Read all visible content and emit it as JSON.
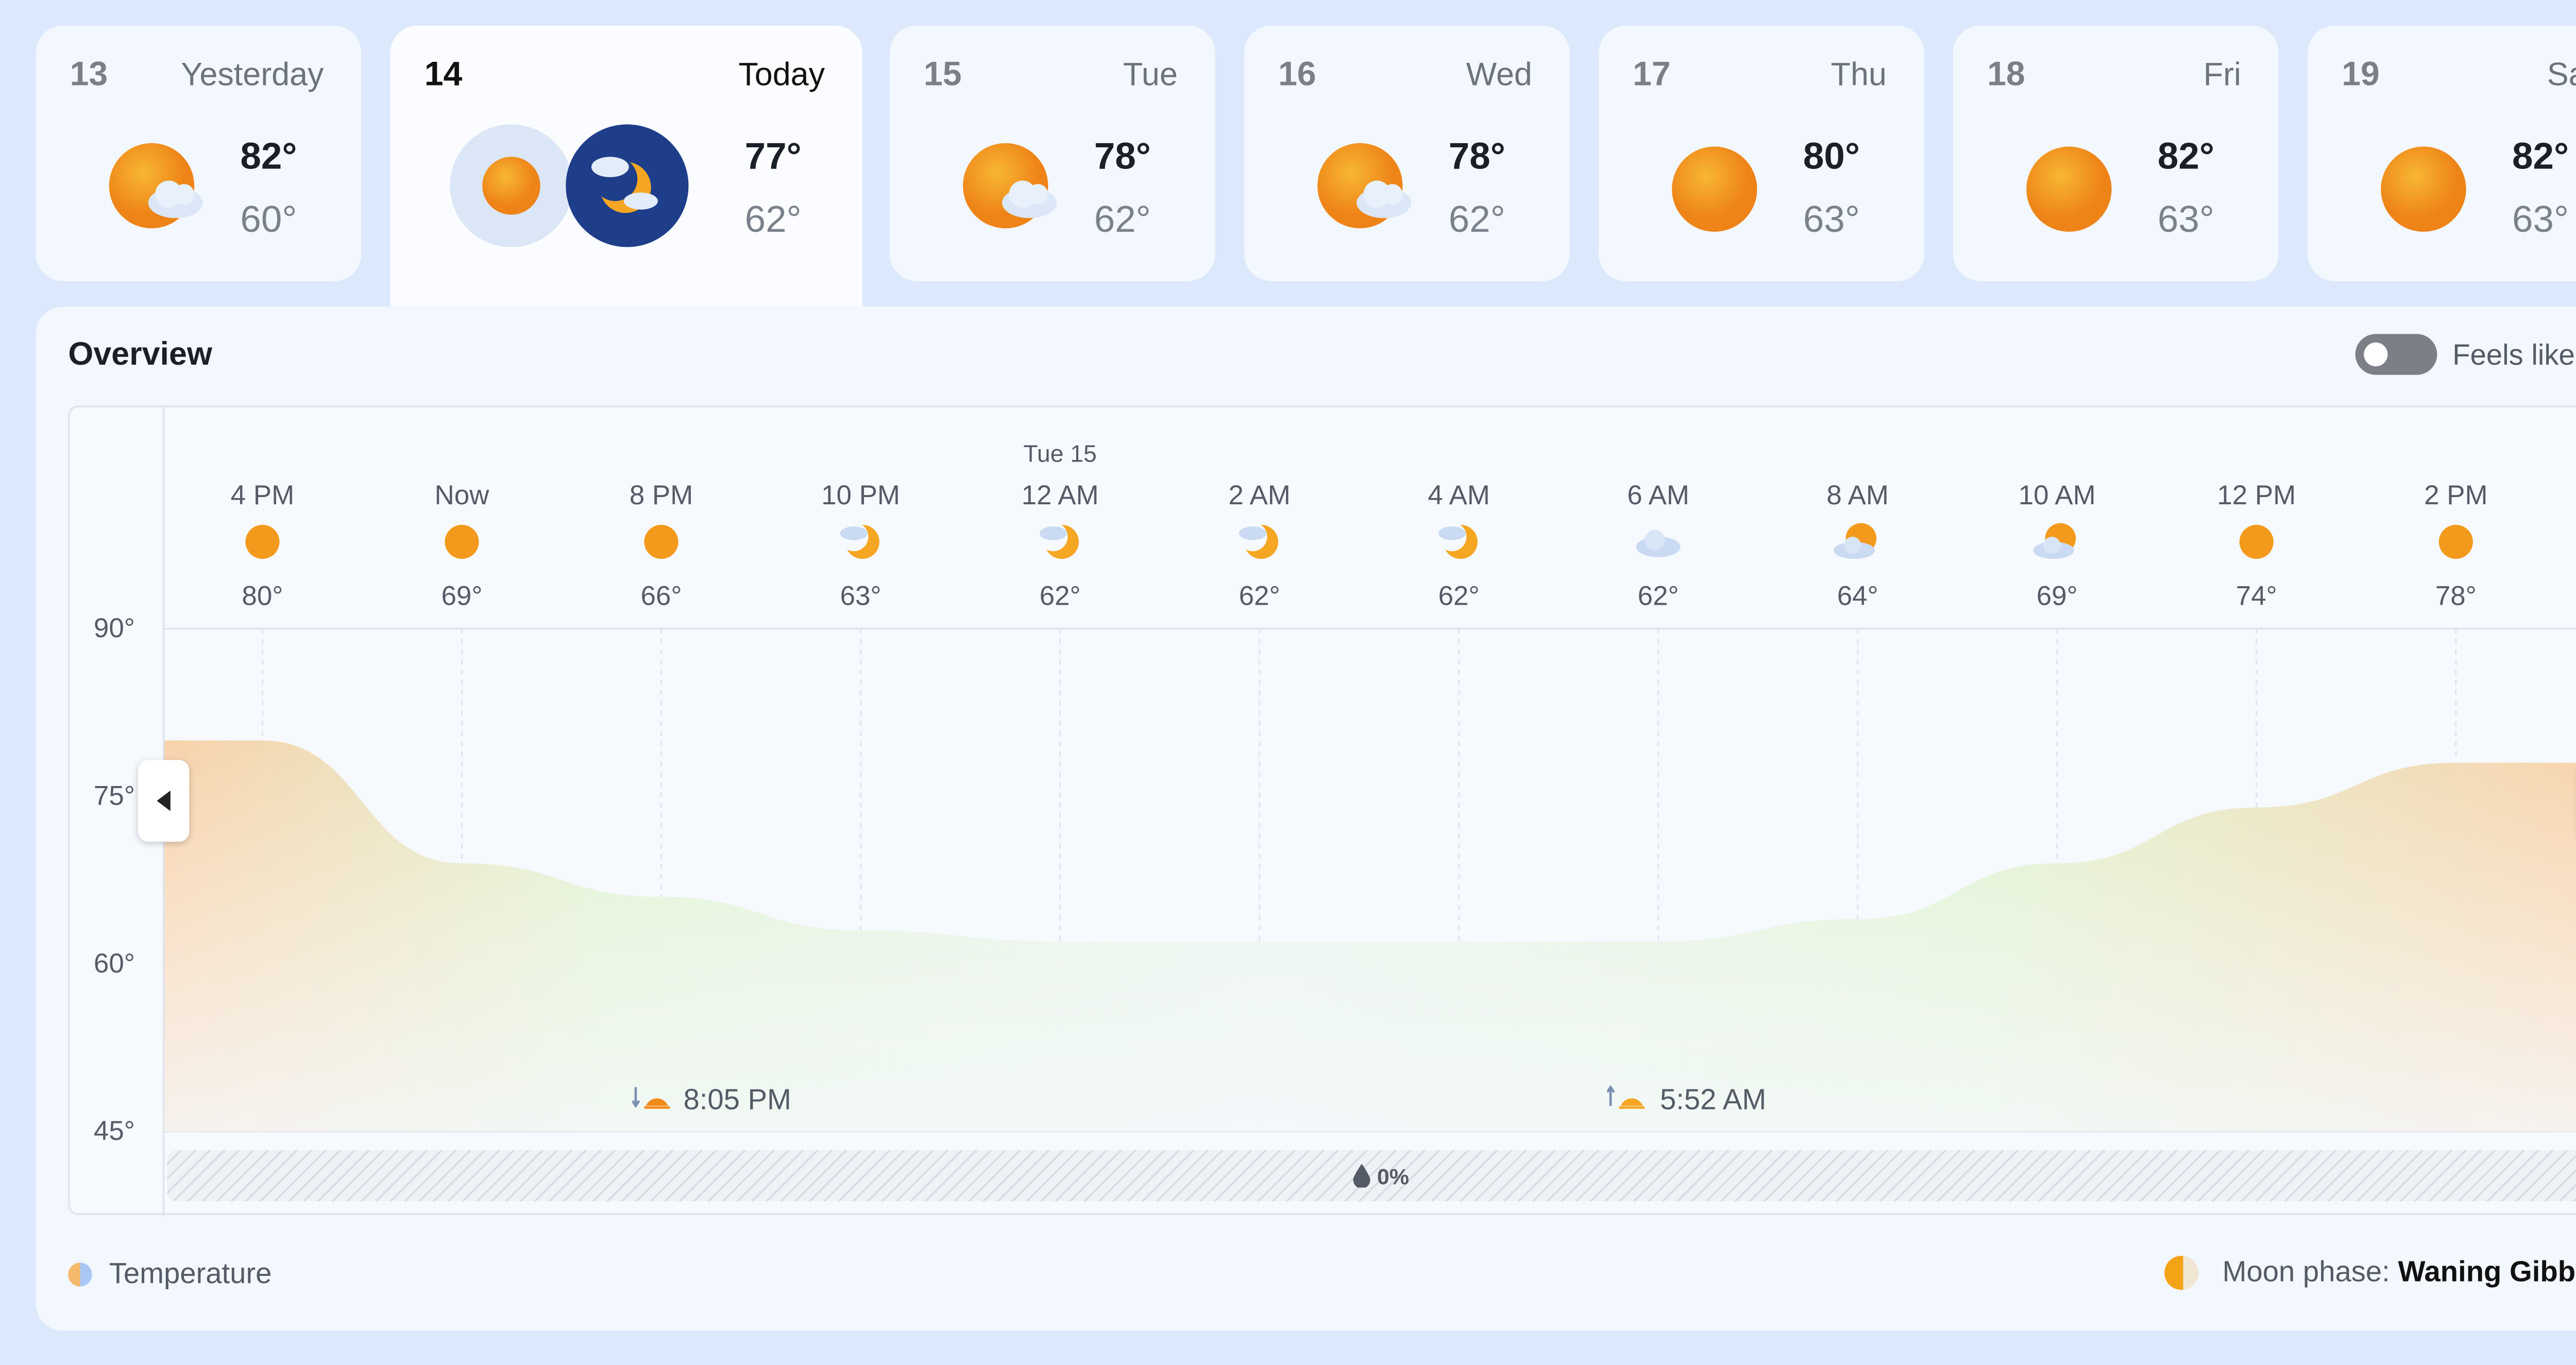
{
  "days": [
    {
      "num": "13",
      "label": "Yesterday",
      "high": "82°",
      "low": "60°",
      "icon": "sun-cloud-icon"
    },
    {
      "num": "14",
      "label": "Today",
      "high": "77°",
      "low": "62°",
      "icon": "sun-and-moon-icon"
    },
    {
      "num": "15",
      "label": "Tue",
      "high": "78°",
      "low": "62°",
      "icon": "sun-cloud-icon"
    },
    {
      "num": "16",
      "label": "Wed",
      "high": "78°",
      "low": "62°",
      "icon": "sun-cloud-icon"
    },
    {
      "num": "17",
      "label": "Thu",
      "high": "80°",
      "low": "63°",
      "icon": "sun-icon"
    },
    {
      "num": "18",
      "label": "Fri",
      "high": "82°",
      "low": "63°",
      "icon": "sun-icon"
    },
    {
      "num": "19",
      "label": "Sat",
      "high": "82°",
      "low": "63°",
      "icon": "sun-icon"
    }
  ],
  "overview": {
    "title": "Overview",
    "feels_like": "Feels like",
    "feels_like_on": false,
    "date_marker": "Tue 15",
    "sunset": "8:05 PM",
    "sunrise": "5:52 AM",
    "precip": "0%",
    "legend_temperature": "Temperature",
    "moon_label": "Moon phase:",
    "moon_phase": "Waning Gibbous"
  },
  "chart_data": {
    "type": "area",
    "categories": [
      "4 PM",
      "Now",
      "8 PM",
      "10 PM",
      "12 AM",
      "2 AM",
      "4 AM",
      "6 AM",
      "8 AM",
      "10 AM",
      "12 PM",
      "2 PM"
    ],
    "values": [
      80,
      69,
      66,
      63,
      62,
      62,
      62,
      62,
      64,
      69,
      74,
      78
    ],
    "labels": [
      "80°",
      "69°",
      "66°",
      "63°",
      "62°",
      "62°",
      "62°",
      "62°",
      "64°",
      "69°",
      "74°",
      "78°"
    ],
    "icons": [
      "sun-icon",
      "sun-icon",
      "sun-icon",
      "moon-cloud-icon",
      "moon-cloud-icon",
      "moon-cloud-icon",
      "moon-cloud-icon",
      "cloud-icon",
      "sun-cloud-icon",
      "sun-cloud-icon",
      "sun-icon",
      "sun-icon"
    ],
    "y_ticks": [
      "90°",
      "75°",
      "60°",
      "45°"
    ],
    "ylim": [
      45,
      90
    ],
    "grid": true
  },
  "colors": {
    "sun": "#f5a623",
    "cloud": "#c9daf2",
    "night": "#1e3e8a",
    "warm": "#f6c79a",
    "cool": "#d9f0d0"
  }
}
